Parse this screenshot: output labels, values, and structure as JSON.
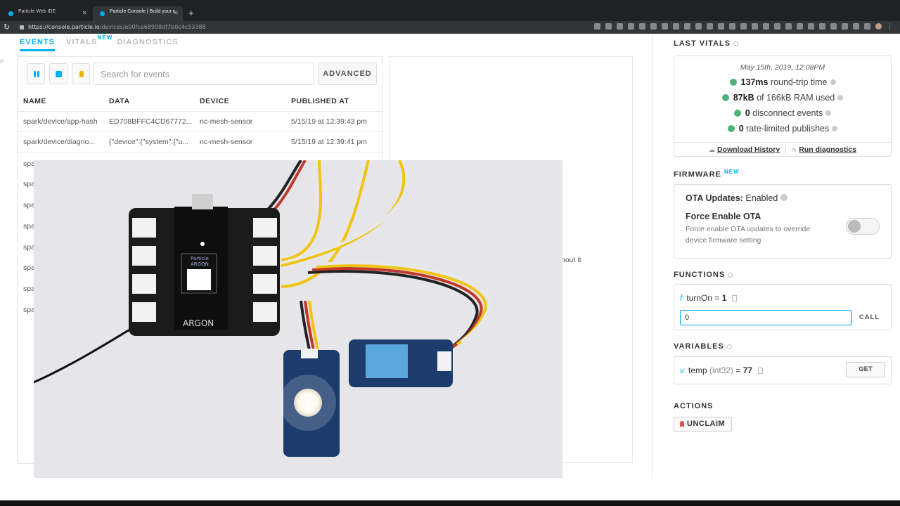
{
  "browser": {
    "tabs": [
      {
        "title": "Particle Web IDE"
      },
      {
        "title": "Particle Console | Build your c"
      }
    ],
    "url_host": "https://console.particle.io",
    "url_path": "/devices/e00fce68998df7b0c4c53388"
  },
  "subtabs": [
    {
      "label": "EVENTS"
    },
    {
      "label": "VITALS",
      "badge": "NEW"
    },
    {
      "label": "DIAGNOSTICS"
    }
  ],
  "events": {
    "search_placeholder": "Search for events",
    "advanced_label": "ADVANCED",
    "columns": [
      "NAME",
      "DATA",
      "DEVICE",
      "PUBLISHED AT"
    ],
    "rows": [
      {
        "name": "spark/device/app-hash",
        "data": "ED708BFFC4CD67772...",
        "device": "nc-mesh-sensor",
        "published": "5/15/19 at 12:39:43 pm"
      },
      {
        "name": "spark/device/diagno...",
        "data": "{\"device\":{\"system\":{\"u...",
        "device": "nc-mesh-sensor",
        "published": "5/15/19 at 12:39:41 pm"
      }
    ],
    "stub_rows": [
      "spa",
      "spa",
      "spa",
      "spa",
      "spa",
      "spa",
      "spa",
      "spa"
    ],
    "about_text": "bout it"
  },
  "vitals": {
    "title": "LAST VITALS",
    "date": "May 15th, 2019, 12:08PM",
    "lines": [
      {
        "value": "137ms",
        "text": " round-trip time"
      },
      {
        "value": "87kB",
        "text": " of 166kB RAM used"
      },
      {
        "value": "0",
        "text": " disconnect events"
      },
      {
        "value": "0",
        "text": " rate-limited publishes"
      }
    ],
    "download_history": "Download History",
    "run_diagnostics": "Run diagnostics"
  },
  "firmware": {
    "title": "FIRMWARE",
    "badge": "NEW",
    "ota_label": "OTA Updates:",
    "ota_value": " Enabled",
    "force_title": "Force Enable OTA",
    "force_desc": "Force enable OTA updates to override device firmware setting",
    "force_enabled": false
  },
  "functions": {
    "title": "FUNCTIONS",
    "name": "turnOn",
    "result": "1",
    "input_value": "0",
    "call_label": "CALL"
  },
  "variables": {
    "title": "VARIABLES",
    "name": "temp",
    "type": "(int32)",
    "value": "77",
    "get_label": "GET"
  },
  "actions": {
    "title": "ACTIONS",
    "unclaim_label": "UNCLAIM"
  },
  "photo": {
    "board_brand": "Particle",
    "board_model": "ARGON",
    "board_label": "ARGON"
  },
  "colors": {
    "accent": "#00aeef",
    "success": "#4fb27a",
    "danger": "#d9534f"
  }
}
